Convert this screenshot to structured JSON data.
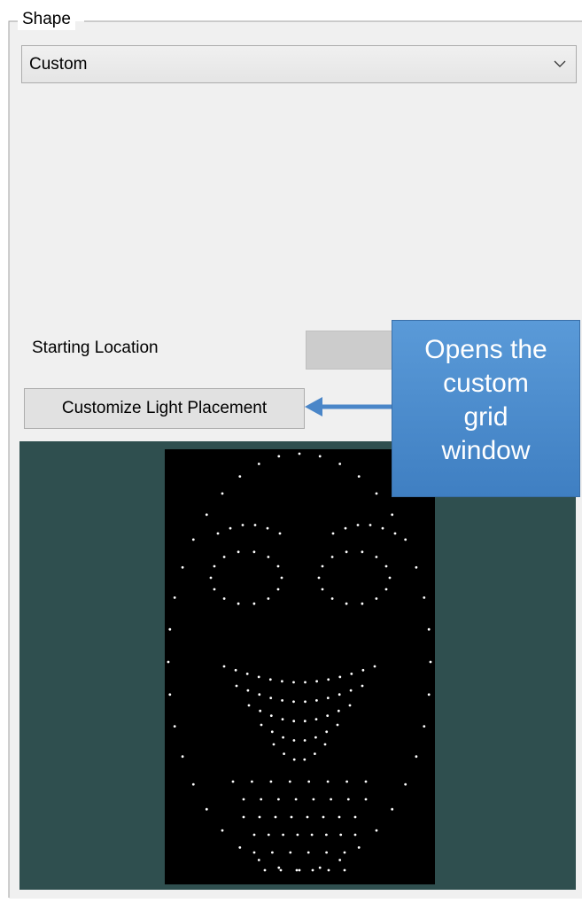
{
  "group": {
    "label": "Shape"
  },
  "shape_select": {
    "value": "Custom"
  },
  "starting_location": {
    "label": "Starting Location"
  },
  "customize_button": {
    "label": "Customize Light Placement"
  },
  "callout": {
    "lines": [
      "Opens the",
      "custom",
      "grid",
      "window"
    ]
  },
  "colors": {
    "panel_bg": "#f0f0f0",
    "preview_bg": "#2f4f4f",
    "canvas_bg": "#000000",
    "light": "#ffffff",
    "callout_bg": "#4f8fd0"
  },
  "icons": {
    "dropdown": "chevron-down-icon",
    "callout_arrow": "arrow-left-icon"
  }
}
